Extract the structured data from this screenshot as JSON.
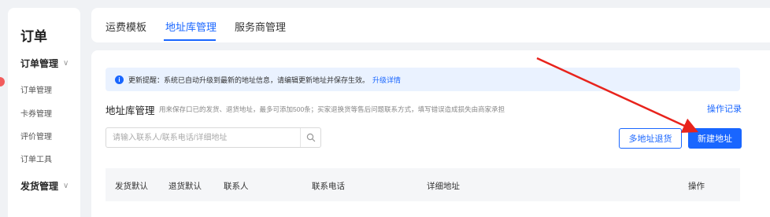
{
  "sidebar": {
    "title": "订单",
    "groups": [
      {
        "label": "订单管理",
        "items": [
          "订单管理",
          "卡券管理",
          "评价管理",
          "订单工具"
        ]
      },
      {
        "label": "发货管理"
      }
    ]
  },
  "tabs": [
    {
      "label": "运费模板",
      "active": false
    },
    {
      "label": "地址库管理",
      "active": true
    },
    {
      "label": "服务商管理",
      "active": false
    }
  ],
  "notice": {
    "icon": "info-icon",
    "text": "更新提醒：系统已自动升级到最新的地址信息，请编辑更新地址并保存生效。",
    "link": "升级详情"
  },
  "section": {
    "title": "地址库管理",
    "description": "用来保存口已的发货、退货地址，最多可添加500条；买家退换货等售后问题联系方式，填写错误造成损失由商家承担",
    "op_record": "操作记录"
  },
  "search": {
    "placeholder": "请输入联系人/联系电话/详细地址",
    "value": ""
  },
  "buttons": {
    "multi_return": "多地址退货",
    "new_address": "新建地址"
  },
  "table": {
    "columns": [
      "发货默认",
      "退货默认",
      "联系人",
      "联系电话",
      "详细地址",
      "操作"
    ]
  },
  "colors": {
    "accent": "#1966ff",
    "notice_bg": "#eaf2ff",
    "annotation_arrow": "#e8231c"
  }
}
